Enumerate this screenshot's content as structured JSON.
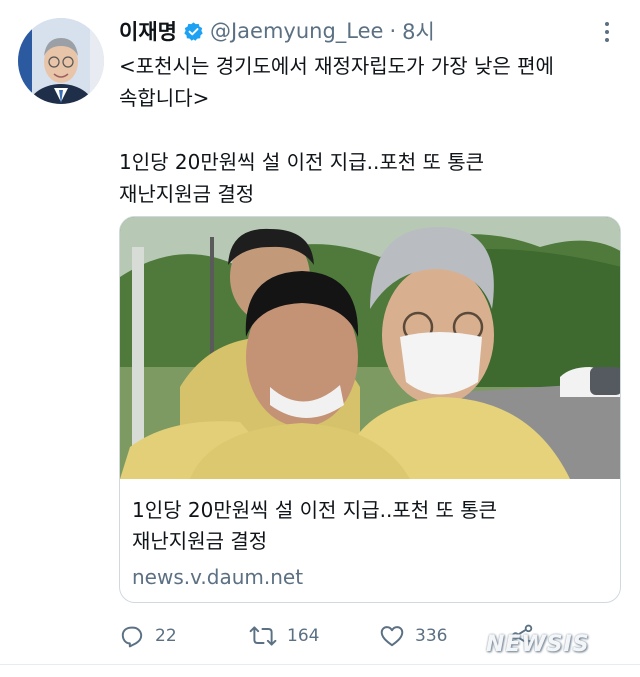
{
  "author": {
    "name": "이재명",
    "handle": "@Jaemyung_Lee",
    "separator": "·",
    "time": "8시"
  },
  "tweet": {
    "line1": "<포천시는 경기도에서 재정자립도가 가장 낮은 편에",
    "line2": "속합니다>",
    "line3": "1인당 20만원씩 설 이전 지급..포천 또 통큰",
    "line4": "재난지원금 결정"
  },
  "card": {
    "title_line1": "1인당 20만원씩 설 이전 지급..포천 또 통큰",
    "title_line2": "재난지원금 결정",
    "domain": "news.v.daum.net"
  },
  "actions": {
    "reply_count": "22",
    "retweet_count": "164",
    "like_count": "336"
  },
  "icons": {
    "verified": "verified-badge-icon",
    "more": "more-options-icon",
    "reply": "reply-icon",
    "retweet": "retweet-icon",
    "like": "heart-icon",
    "share": "share-icon"
  },
  "colors": {
    "accent": "#1da1f2",
    "muted": "#5b7083",
    "text": "#0f1419"
  },
  "watermark": "NEWSIS"
}
